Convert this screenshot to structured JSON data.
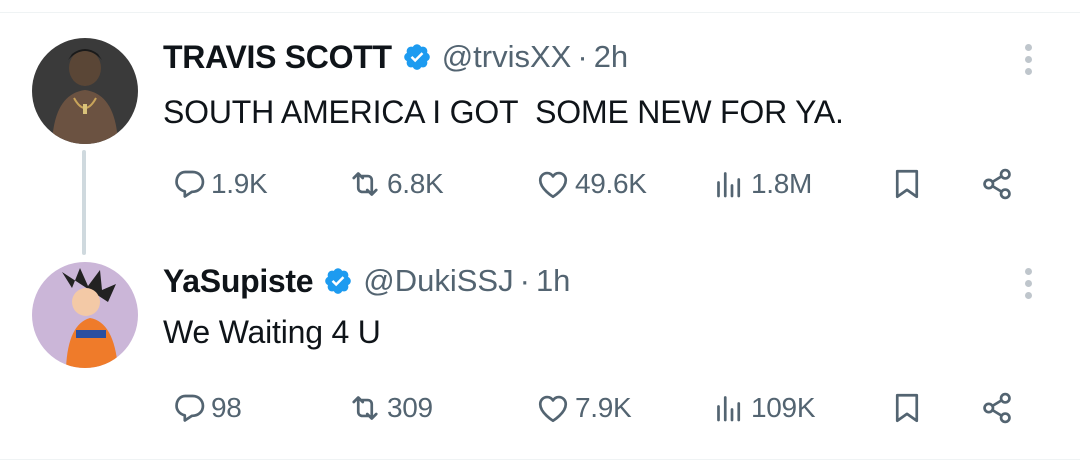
{
  "tweets": [
    {
      "author": "TRAVIS SCOTT",
      "handle": "@trvisXX",
      "separator": "·",
      "time": "2h",
      "text": "SOUTH AMERICA I GOT  SOME NEW FOR YA.",
      "stats": {
        "replies": "1.9K",
        "retweets": "6.8K",
        "likes": "49.6K",
        "views": "1.8M"
      }
    },
    {
      "author": "YaSupiste",
      "handle": "@DukiSSJ",
      "separator": "·",
      "time": "1h",
      "text": "We Waiting 4 U",
      "stats": {
        "replies": "98",
        "retweets": "309",
        "likes": "7.9K",
        "views": "109K"
      }
    }
  ],
  "colors": {
    "verified": "#1d9bf0",
    "muted": "#536471",
    "text": "#0f1419"
  },
  "icons": [
    "reply-icon",
    "retweet-icon",
    "like-icon",
    "views-icon",
    "bookmark-icon",
    "share-icon",
    "verified-badge-icon",
    "more-icon"
  ]
}
